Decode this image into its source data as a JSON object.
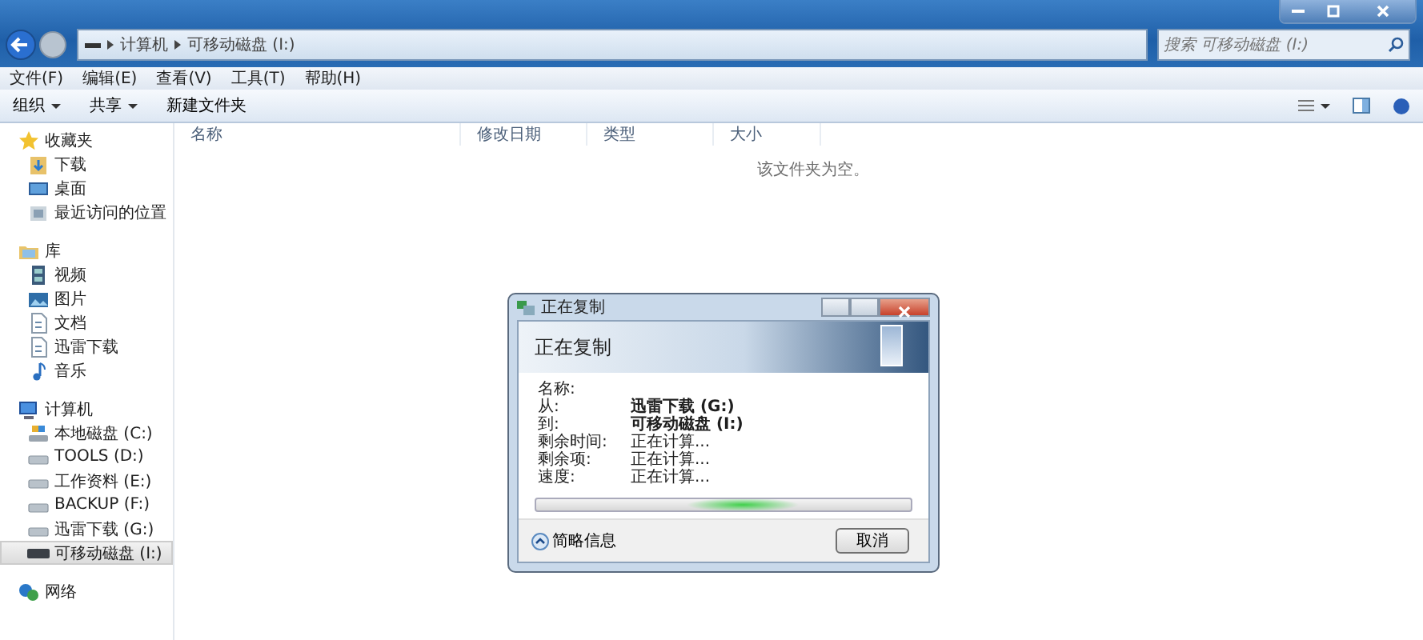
{
  "address_bar": {
    "path": [
      "计算机",
      "可移动磁盘 (I:)"
    ]
  },
  "search": {
    "placeholder": "搜索 可移动磁盘 (I:)"
  },
  "menu": [
    "文件(F)",
    "编辑(E)",
    "查看(V)",
    "工具(T)",
    "帮助(H)"
  ],
  "toolbar": [
    {
      "label": "组织",
      "kind": "dropdown"
    },
    {
      "label": "共享",
      "kind": "dropdown"
    },
    {
      "label": "新建文件夹",
      "kind": "plain"
    }
  ],
  "sidebar": [
    {
      "label": "收藏夹",
      "kind": "star",
      "selected": false,
      "children": [
        {
          "label": "下载",
          "kind": "download",
          "selected": false
        },
        {
          "label": "桌面",
          "kind": "desktop",
          "selected": false
        },
        {
          "label": "最近访问的位置",
          "kind": "recent",
          "selected": false
        }
      ]
    },
    {
      "label": "库",
      "kind": "library",
      "selected": false,
      "children": [
        {
          "label": "视频",
          "kind": "video",
          "selected": false
        },
        {
          "label": "图片",
          "kind": "picture",
          "selected": false
        },
        {
          "label": "文档",
          "kind": "document",
          "selected": false
        },
        {
          "label": "迅雷下载",
          "kind": "document",
          "selected": false
        },
        {
          "label": "音乐",
          "kind": "music",
          "selected": false
        }
      ]
    },
    {
      "label": "计算机",
      "kind": "computer",
      "selected": false,
      "children": [
        {
          "label": "本地磁盘 (C:)",
          "kind": "system-drive",
          "selected": false
        },
        {
          "label": "TOOLS (D:)",
          "kind": "drive",
          "selected": false
        },
        {
          "label": "工作资料 (E:)",
          "kind": "drive",
          "selected": false
        },
        {
          "label": "BACKUP (F:)",
          "kind": "drive",
          "selected": false
        },
        {
          "label": "迅雷下载 (G:)",
          "kind": "drive",
          "selected": false
        },
        {
          "label": "可移动磁盘 (I:)",
          "kind": "removable",
          "selected": true
        }
      ]
    },
    {
      "label": "网络",
      "kind": "network",
      "selected": false
    }
  ],
  "columns": [
    "名称",
    "修改日期",
    "类型",
    "大小"
  ],
  "empty_message": "该文件夹为空。",
  "dialog": {
    "title": "正在复制",
    "heading": "正在复制",
    "fields": [
      {
        "label": "名称:"
      },
      {
        "label": "从:",
        "value": "迅雷下载 (G:)",
        "bold": true
      },
      {
        "label": "到:",
        "value": "可移动磁盘 (I:)",
        "bold": true
      },
      {
        "label": "剩余时间:",
        "value": "正在计算...",
        "bold": false
      },
      {
        "label": "剩余项:",
        "value": "正在计算...",
        "bold": false
      },
      {
        "label": "速度:",
        "value": "正在计算...",
        "bold": false
      }
    ],
    "progress": {
      "indeterminate": true
    },
    "details_button": "简略信息",
    "cancel_button": "取消"
  }
}
